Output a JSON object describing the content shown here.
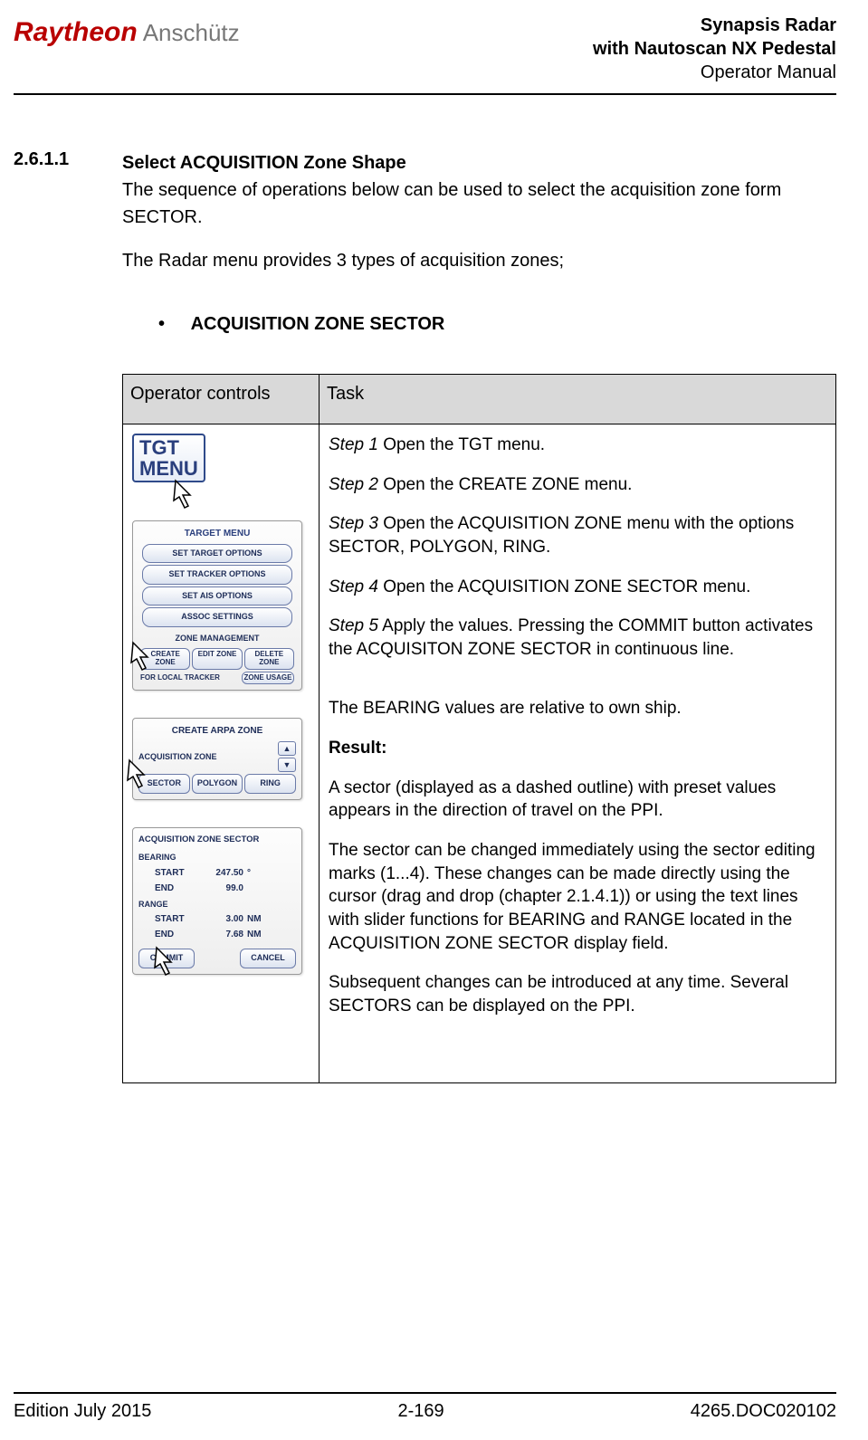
{
  "header": {
    "logo_red": "Raytheon",
    "logo_grey": "Anschütz",
    "title_line1": "Synapsis Radar",
    "title_line2": "with Nautoscan NX Pedestal",
    "title_line3": "Operator Manual"
  },
  "section": {
    "number": "2.6.1.1",
    "title": "Select ACQUISITION Zone Shape",
    "para1": "The sequence of operations below can be used to select the acquisition zone form SECTOR.",
    "para2": "The Radar menu provides 3 types of acquisition zones;"
  },
  "bullet": {
    "dot": "•",
    "text": "ACQUISITION ZONE SECTOR"
  },
  "table": {
    "head_left": "Operator controls",
    "head_right": "Task",
    "widgets": {
      "tgt_menu_line1": "TGT",
      "tgt_menu_line2": "MENU",
      "target_menu": {
        "title": "TARGET MENU",
        "btn1": "SET TARGET OPTIONS",
        "btn2": "SET TRACKER OPTIONS",
        "btn3": "SET AIS OPTIONS",
        "btn4": "ASSOC SETTINGS",
        "sub": "ZONE MANAGEMENT",
        "row_a": "CREATE ZONE",
        "row_b": "EDIT ZONE",
        "row_c": "DELETE ZONE",
        "row2_lbl": "FOR LOCAL TRACKER",
        "row2_btn": "ZONE USAGE"
      },
      "arpa": {
        "title": "CREATE ARPA ZONE",
        "label": "ACQUISITION ZONE",
        "up": "▲",
        "down": "▼",
        "b1": "SECTOR",
        "b2": "POLYGON",
        "b3": "RING"
      },
      "sector": {
        "title": "ACQUISITION ZONE SECTOR",
        "grp1": "BEARING",
        "r1k": "START",
        "r1v": "247.50",
        "r1u": "°",
        "r2k": "END",
        "r2v": "99.0",
        "r2u": "",
        "grp2": "RANGE",
        "r3k": "START",
        "r3v": "3.00",
        "r3u": "NM",
        "r4k": "END",
        "r4v": "7.68",
        "r4u": "NM",
        "commit": "COMMIT",
        "cancel": "CANCEL"
      }
    },
    "task": {
      "s1a": "Step 1",
      "s1b": " Open the TGT menu.",
      "s2a": "Step 2",
      "s2b": " Open the CREATE ZONE menu.",
      "s3a": "Step 3",
      "s3b": " Open the ACQUISITION ZONE menu with the options SECTOR, POLYGON, RING.",
      "s4a": "Step 4",
      "s4b": " Open the ACQUISITION ZONE SECTOR menu.",
      "s5a": "Step 5",
      "s5b": " Apply the values. Pressing the COMMIT button activates the ACQUISITON ZONE SECTOR in continuous line.",
      "p6": "The BEARING values are relative to own ship.",
      "res": "Result:",
      "p7": "A sector (displayed as a dashed outline) with preset values appears in the direction of travel on the PPI.",
      "p8": "The sector can be changed immediately using the sector editing marks (1...4). These changes can be made directly using the cursor (drag and drop (chapter 2.1.4.1)) or using the text lines with slider functions for BEARING and RANGE located in the ACQUISITION ZONE SECTOR display field.",
      "p9": "Subsequent changes can be introduced at any time. Several SECTORS can be displayed on the PPI."
    }
  },
  "footer": {
    "left": "Edition July 2015",
    "center": "2-169",
    "right": "4265.DOC020102"
  }
}
